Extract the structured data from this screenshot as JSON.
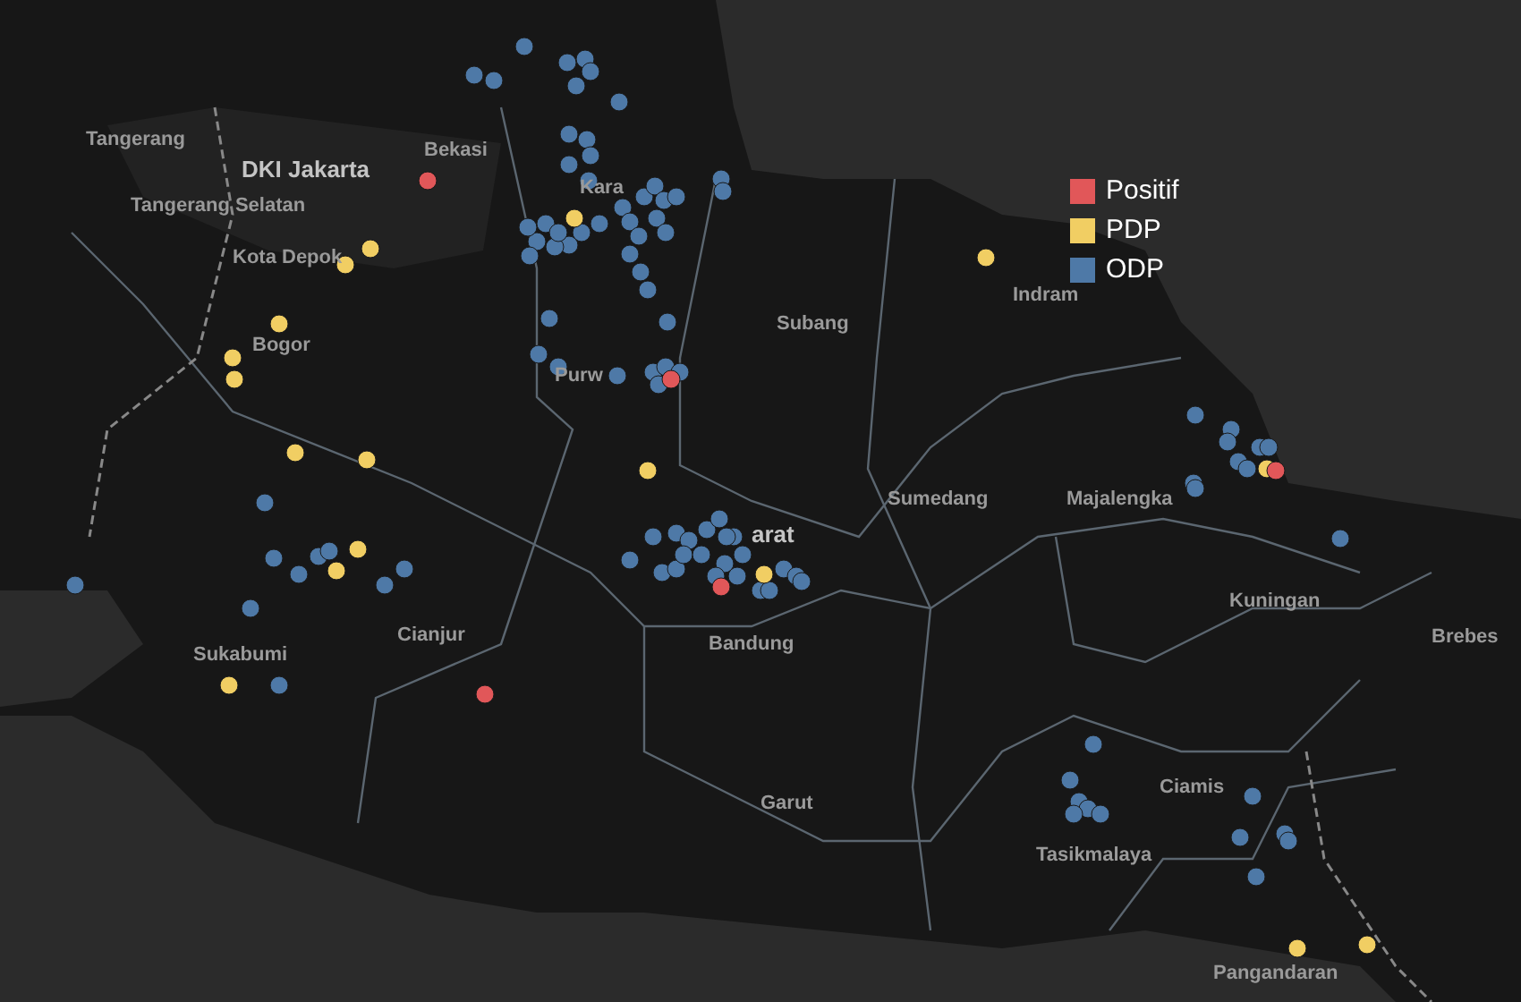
{
  "map": {
    "labels": [
      {
        "text": "Tangerang",
        "kind": "region"
      },
      {
        "text": "DKI Jakarta",
        "kind": "province"
      },
      {
        "text": "Bekasi",
        "kind": "region"
      },
      {
        "text": "Tangerang Selatan",
        "kind": "region"
      },
      {
        "text": "Kota Depok",
        "kind": "region"
      },
      {
        "text": "Bogor",
        "kind": "region"
      },
      {
        "text": "Kara",
        "kind": "region"
      },
      {
        "text": "Subang",
        "kind": "region"
      },
      {
        "text": "Indram",
        "kind": "region"
      },
      {
        "text": "Purw",
        "kind": "region"
      },
      {
        "text": "arat",
        "kind": "province"
      },
      {
        "text": "Sumedang",
        "kind": "region"
      },
      {
        "text": "Majalengka",
        "kind": "region"
      },
      {
        "text": "Kuningan",
        "kind": "region"
      },
      {
        "text": "Cianjur",
        "kind": "region"
      },
      {
        "text": "Bandung",
        "kind": "region"
      },
      {
        "text": "Brebes",
        "kind": "region"
      },
      {
        "text": "Sukabumi",
        "kind": "region"
      },
      {
        "text": "Garut",
        "kind": "region"
      },
      {
        "text": "Ciamis",
        "kind": "region"
      },
      {
        "text": "Tasikmalaya",
        "kind": "region"
      },
      {
        "text": "Pangandaran",
        "kind": "region"
      }
    ]
  },
  "legend": [
    {
      "label": "Positif",
      "color": "#e15759"
    },
    {
      "label": "PDP",
      "color": "#f1ce63"
    },
    {
      "label": "ODP",
      "color": "#4e79a7"
    }
  ]
}
